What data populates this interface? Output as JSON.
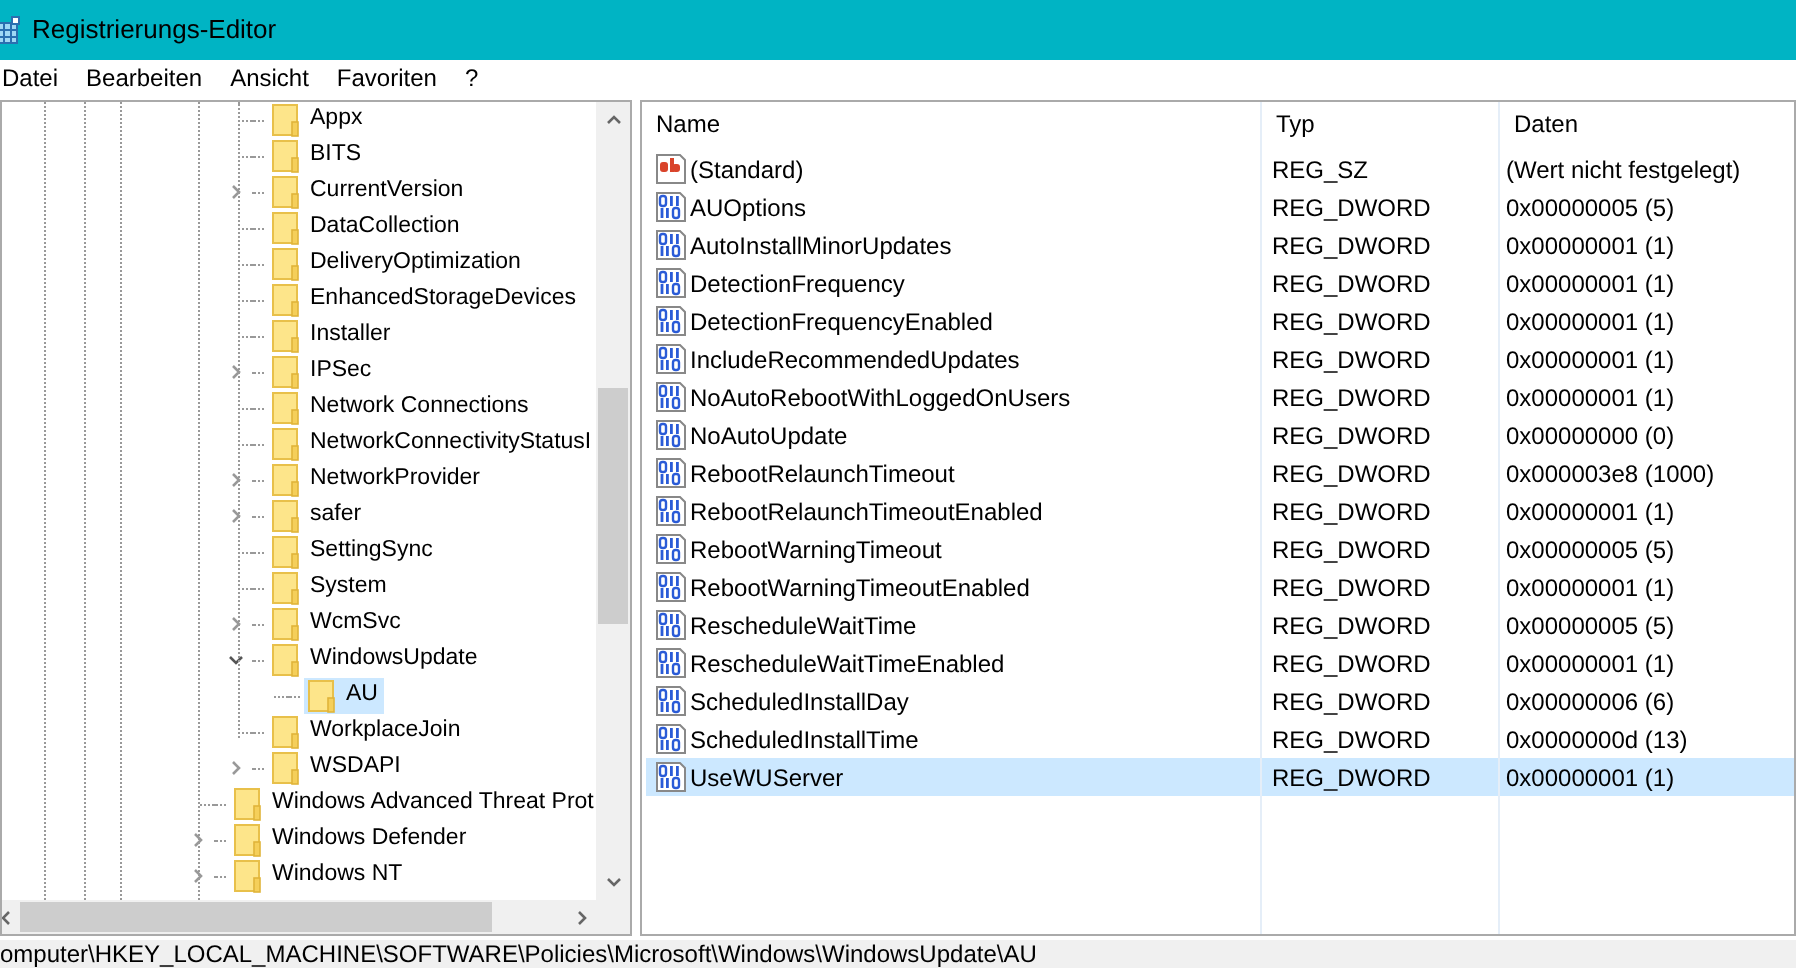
{
  "window": {
    "title": "Registrierungs-Editor"
  },
  "menu": [
    "Datei",
    "Bearbeiten",
    "Ansicht",
    "Favoriten",
    "?"
  ],
  "tree": {
    "items": [
      {
        "label": "Appx",
        "kind": "leaf",
        "expanded": false,
        "selected": false
      },
      {
        "label": "BITS",
        "kind": "leaf",
        "expanded": false,
        "selected": false
      },
      {
        "label": "CurrentVersion",
        "kind": "node",
        "expanded": false,
        "selected": false
      },
      {
        "label": "DataCollection",
        "kind": "leaf",
        "expanded": false,
        "selected": false
      },
      {
        "label": "DeliveryOptimization",
        "kind": "leaf",
        "expanded": false,
        "selected": false
      },
      {
        "label": "EnhancedStorageDevices",
        "kind": "leaf",
        "expanded": false,
        "selected": false
      },
      {
        "label": "Installer",
        "kind": "leaf",
        "expanded": false,
        "selected": false
      },
      {
        "label": "IPSec",
        "kind": "node",
        "expanded": false,
        "selected": false
      },
      {
        "label": "Network Connections",
        "kind": "leaf",
        "expanded": false,
        "selected": false
      },
      {
        "label": "NetworkConnectivityStatusI",
        "kind": "leaf",
        "expanded": false,
        "selected": false
      },
      {
        "label": "NetworkProvider",
        "kind": "node",
        "expanded": false,
        "selected": false
      },
      {
        "label": "safer",
        "kind": "node",
        "expanded": false,
        "selected": false
      },
      {
        "label": "SettingSync",
        "kind": "leaf",
        "expanded": false,
        "selected": false
      },
      {
        "label": "System",
        "kind": "leaf",
        "expanded": false,
        "selected": false
      },
      {
        "label": "WcmSvc",
        "kind": "node",
        "expanded": false,
        "selected": false
      },
      {
        "label": "WindowsUpdate",
        "kind": "node",
        "expanded": true,
        "selected": false,
        "children": [
          {
            "label": "AU",
            "kind": "leaf",
            "expanded": false,
            "selected": true
          }
        ]
      },
      {
        "label": "WorkplaceJoin",
        "kind": "leaf",
        "expanded": false,
        "selected": false
      },
      {
        "label": "WSDAPI",
        "kind": "node",
        "expanded": false,
        "selected": false
      }
    ],
    "parent_siblings": [
      {
        "label": "Windows Advanced Threat Prot",
        "kind": "leaf",
        "expanded": false,
        "selected": false
      },
      {
        "label": "Windows Defender",
        "kind": "node",
        "expanded": false,
        "selected": false
      },
      {
        "label": "Windows NT",
        "kind": "node",
        "expanded": false,
        "selected": false
      }
    ]
  },
  "table": {
    "columns": [
      "Name",
      "Typ",
      "Daten"
    ],
    "rows": [
      {
        "kind": "string",
        "name": "(Standard)",
        "type": "REG_SZ",
        "data": "(Wert nicht festgelegt)",
        "selected": false
      },
      {
        "kind": "binary",
        "name": "AUOptions",
        "type": "REG_DWORD",
        "data": "0x00000005 (5)",
        "selected": false
      },
      {
        "kind": "binary",
        "name": "AutoInstallMinorUpdates",
        "type": "REG_DWORD",
        "data": "0x00000001 (1)",
        "selected": false
      },
      {
        "kind": "binary",
        "name": "DetectionFrequency",
        "type": "REG_DWORD",
        "data": "0x00000001 (1)",
        "selected": false
      },
      {
        "kind": "binary",
        "name": "DetectionFrequencyEnabled",
        "type": "REG_DWORD",
        "data": "0x00000001 (1)",
        "selected": false
      },
      {
        "kind": "binary",
        "name": "IncludeRecommendedUpdates",
        "type": "REG_DWORD",
        "data": "0x00000001 (1)",
        "selected": false
      },
      {
        "kind": "binary",
        "name": "NoAutoRebootWithLoggedOnUsers",
        "type": "REG_DWORD",
        "data": "0x00000001 (1)",
        "selected": false
      },
      {
        "kind": "binary",
        "name": "NoAutoUpdate",
        "type": "REG_DWORD",
        "data": "0x00000000 (0)",
        "selected": false
      },
      {
        "kind": "binary",
        "name": "RebootRelaunchTimeout",
        "type": "REG_DWORD",
        "data": "0x000003e8 (1000)",
        "selected": false
      },
      {
        "kind": "binary",
        "name": "RebootRelaunchTimeoutEnabled",
        "type": "REG_DWORD",
        "data": "0x00000001 (1)",
        "selected": false
      },
      {
        "kind": "binary",
        "name": "RebootWarningTimeout",
        "type": "REG_DWORD",
        "data": "0x00000005 (5)",
        "selected": false
      },
      {
        "kind": "binary",
        "name": "RebootWarningTimeoutEnabled",
        "type": "REG_DWORD",
        "data": "0x00000001 (1)",
        "selected": false
      },
      {
        "kind": "binary",
        "name": "RescheduleWaitTime",
        "type": "REG_DWORD",
        "data": "0x00000005 (5)",
        "selected": false
      },
      {
        "kind": "binary",
        "name": "RescheduleWaitTimeEnabled",
        "type": "REG_DWORD",
        "data": "0x00000001 (1)",
        "selected": false
      },
      {
        "kind": "binary",
        "name": "ScheduledInstallDay",
        "type": "REG_DWORD",
        "data": "0x00000006 (6)",
        "selected": false
      },
      {
        "kind": "binary",
        "name": "ScheduledInstallTime",
        "type": "REG_DWORD",
        "data": "0x0000000d (13)",
        "selected": false
      },
      {
        "kind": "binary",
        "name": "UseWUServer",
        "type": "REG_DWORD",
        "data": "0x00000001 (1)",
        "selected": true
      }
    ]
  },
  "status_bar": "omputer\\HKEY_LOCAL_MACHINE\\SOFTWARE\\Policies\\Microsoft\\Windows\\WindowsUpdate\\AU"
}
